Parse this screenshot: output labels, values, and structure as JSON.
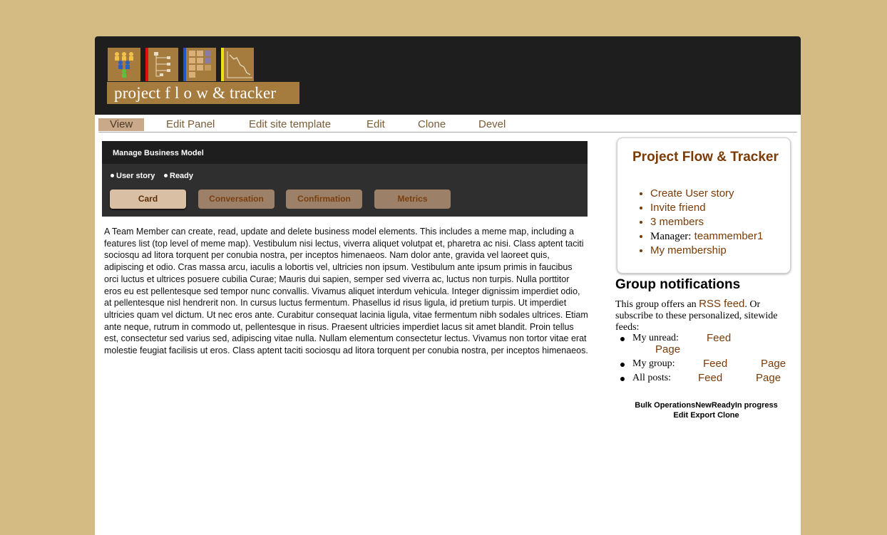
{
  "header": {
    "logo_text": "project f l o w & tracker",
    "logo_stripe_colors": [
      "#a67c3e",
      "#e01010",
      "#2455c8",
      "#f0e010"
    ]
  },
  "tabs": [
    {
      "label": "View",
      "active": true
    },
    {
      "label": "Edit Panel"
    },
    {
      "label": "Edit site template"
    },
    {
      "label": "Edit"
    },
    {
      "label": "Clone"
    },
    {
      "label": "Devel"
    }
  ],
  "panel": {
    "title": "Manage Business Model",
    "status": [
      "User story",
      "Ready"
    ],
    "buttons": [
      {
        "label": "Card",
        "active": true
      },
      {
        "label": "Conversation"
      },
      {
        "label": "Confirmation"
      },
      {
        "label": "Metrics"
      }
    ]
  },
  "main": {
    "text": "A Team Member can create, read, update and delete business model elements. This includes a meme map, including a features list (top level of meme map). Vestibulum nisi lectus, viverra aliquet volutpat et, pharetra ac nisi. Class aptent taciti sociosqu ad litora torquent per conubia nostra, per inceptos himenaeos. Nam dolor ante, gravida vel laoreet quis, adipiscing et odio. Cras massa arcu, iaculis a lobortis vel, ultricies non ipsum. Vestibulum ante ipsum primis in faucibus orci luctus et ultrices posuere cubilia Curae; Mauris dui sapien, semper sed viverra ac, luctus non turpis. Nulla porttitor eros eu est pellentesque sed tempor nunc convallis. Vivamus aliquet interdum vehicula. Integer dignissim imperdiet odio, at pellentesque nisl hendrerit non. In cursus luctus fermentum. Phasellus id risus ligula, id pretium turpis. Ut imperdiet ultricies quam vel dictum. Ut nec eros ante. Curabitur consequat lacinia ligula, vitae fermentum nibh sodales ultrices. Etiam ante neque, rutrum in commodo ut, pellentesque in risus. Praesent ultricies imperdiet lacus sit amet blandit. Proin tellus est, consectetur sed varius sed, adipiscing vitae nulla. Nullam elementum consectetur lectus. Vivamus non tortor vitae erat molestie feugiat facilisis ut eros. Class aptent taciti sociosqu ad litora torquent per conubia nostra, per inceptos himenaeos."
  },
  "sidebar": {
    "group_title": "Project Flow & Tracker",
    "links": {
      "create": "Create User story",
      "invite": "Invite friend",
      "members": "3 members",
      "manager_label": "Manager:",
      "manager_name": "teammember1",
      "membership": "My membership"
    },
    "notifications": {
      "title": "Group notifications",
      "intro_pre": "This group offers an",
      "rss_link": "RSS feed",
      "intro_post": ". Or subscribe to these personalized, sitewide feeds:",
      "rows": [
        {
          "label": "My unread:",
          "feed": "Feed",
          "page": "Page"
        },
        {
          "label": "My group:",
          "feed": "Feed",
          "page": "Page"
        },
        {
          "label": "All posts:",
          "feed": "Feed",
          "page": "Page"
        }
      ]
    },
    "bulk": {
      "line1": "Bulk OperationsNewReadyIn progress",
      "line2": "Edit Export Clone"
    }
  }
}
